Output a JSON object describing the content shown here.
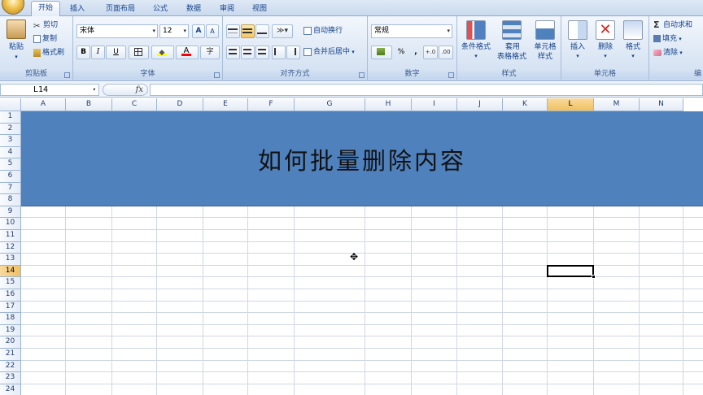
{
  "tabs": [
    "开始",
    "插入",
    "页面布局",
    "公式",
    "数据",
    "审阅",
    "视图"
  ],
  "clipboard": {
    "paste": "粘贴",
    "cut": "剪切",
    "copy": "复制",
    "format_painter": "格式刷",
    "label": "剪贴板"
  },
  "font": {
    "name": "宋体",
    "size": "12",
    "bold": "B",
    "italic": "I",
    "underline": "U",
    "grow": "A",
    "shrink": "A",
    "phonetic": "字",
    "label": "字体"
  },
  "alignment": {
    "wrap": "自动换行",
    "merge": "合并后居中",
    "label": "对齐方式"
  },
  "number": {
    "format": "常规",
    "percent": "%",
    "comma": ",",
    "inc": "+.0",
    "dec": ".00",
    "label": "数字"
  },
  "styles": {
    "conditional": "条件格式",
    "table1": "套用",
    "table2": "表格格式",
    "cell1": "单元格",
    "cell2": "样式",
    "label": "样式"
  },
  "cells": {
    "insert": "插入",
    "delete": "删除",
    "format": "格式",
    "label": "单元格"
  },
  "editing": {
    "autosum": "自动求和",
    "fill": "填充",
    "clear": "清除",
    "label": "编"
  },
  "formula_bar": {
    "name_box": "L14",
    "fx": "fx",
    "content": ""
  },
  "columns": [
    "A",
    "B",
    "C",
    "D",
    "E",
    "F",
    "G",
    "H",
    "I",
    "J",
    "K",
    "L",
    "M",
    "N"
  ],
  "rows": [
    "1",
    "2",
    "3",
    "4",
    "5",
    "6",
    "7",
    "8",
    "9",
    "10",
    "11",
    "12",
    "13",
    "14",
    "15",
    "16",
    "17",
    "18",
    "19",
    "20",
    "21",
    "22",
    "23",
    "24"
  ],
  "selected": {
    "col": "L",
    "row": "14"
  },
  "banner_text": "如何批量删除内容",
  "colors": {
    "banner": "#4f81bd",
    "selected_header": "#f1c15f",
    "ribbon_bg": "#dde8f5"
  },
  "icons": {
    "cursor": "crosshair-icon"
  }
}
